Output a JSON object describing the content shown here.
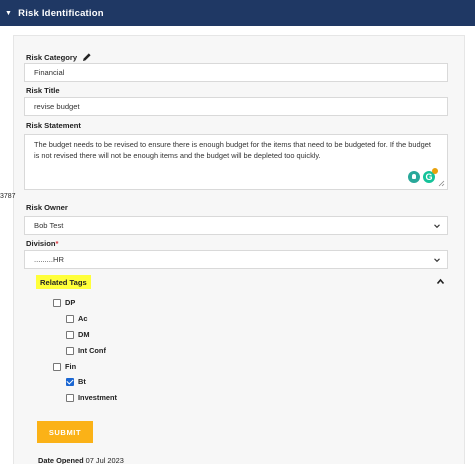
{
  "section": {
    "title": "Risk Identification"
  },
  "form": {
    "category": {
      "label": "Risk Category",
      "value": "Financial"
    },
    "title": {
      "label": "Risk Title",
      "value": "revise budget"
    },
    "statement": {
      "label": "Risk Statement",
      "value": "The budget needs to be revised to ensure there is enough budget for the items that need to be budgeted for. If the budget is not revised there will not be enough items and the budget will be depleted too quickly.",
      "count": "3787"
    },
    "owner": {
      "label": "Risk Owner",
      "value": "Bob Test"
    },
    "division": {
      "label": "Division",
      "required_mark": "*",
      "value": ".........HR"
    },
    "tags": {
      "label": "Related Tags",
      "items": [
        {
          "label": "DP",
          "checked": false
        },
        {
          "label": "Ac",
          "checked": false
        },
        {
          "label": "DM",
          "checked": false
        },
        {
          "label": "Int Conf",
          "checked": false
        },
        {
          "label": "Fin",
          "checked": false
        },
        {
          "label": "Bt",
          "checked": true
        },
        {
          "label": "Investment",
          "checked": false
        }
      ]
    },
    "submit_label": "SUBMIT",
    "date_opened": {
      "label": "Date Opened",
      "value": "07 Jul 2023"
    }
  },
  "colors": {
    "header_bg": "#1f3864",
    "accent": "#fbb217",
    "highlight": "#ffff3a",
    "checkbox": "#1a66d2"
  }
}
